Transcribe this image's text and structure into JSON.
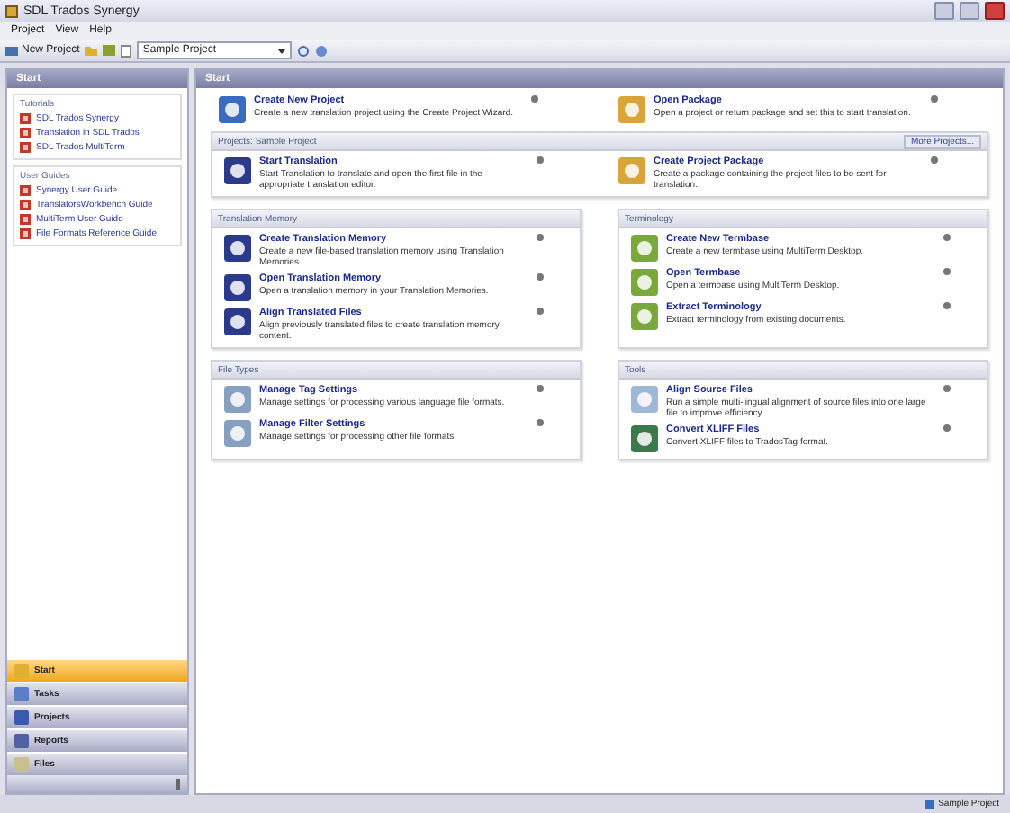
{
  "window": {
    "title": "SDL Trados Synergy"
  },
  "menu": [
    "Project",
    "View",
    "Help"
  ],
  "toolbar": {
    "new_project": "New Project",
    "project_select": "Sample Project"
  },
  "left_pane": {
    "title": "Start",
    "groups": [
      {
        "title": "Tutorials",
        "items": [
          "SDL Trados Synergy",
          "Translation in SDL Trados",
          "SDL Trados MultiTerm"
        ]
      },
      {
        "title": "User Guides",
        "items": [
          "Synergy User Guide",
          "TranslatorsWorkbench Guide",
          "MultiTerm User Guide",
          "File Formats Reference Guide"
        ]
      }
    ]
  },
  "nav": [
    {
      "label": "Start",
      "selected": true
    },
    {
      "label": "Tasks",
      "selected": false
    },
    {
      "label": "Projects",
      "selected": false
    },
    {
      "label": "Reports",
      "selected": false
    },
    {
      "label": "Files",
      "selected": false
    }
  ],
  "main": {
    "title": "Start",
    "top_actions": [
      {
        "title": "Create New Project",
        "desc": "Create a new translation project using the Create Project Wizard."
      },
      {
        "title": "Open Package",
        "desc": "Open a project or return package and set this to start translation."
      }
    ],
    "sections": [
      {
        "title": "Projects: Sample Project",
        "kind": "wide",
        "link": "More Projects...",
        "actions": [
          {
            "title": "Start Translation",
            "desc": "Start Translation to translate and open the first file in the appropriate translation editor."
          },
          {
            "title": "Create Project Package",
            "desc": "Create a package containing the project files to be sent for translation."
          }
        ]
      },
      {
        "title": "Translation Memory",
        "kind": "column",
        "actions": [
          {
            "title": "Create Translation Memory",
            "desc": "Create a new file-based translation memory using Translation Memories."
          },
          {
            "title": "Open Translation Memory",
            "desc": "Open a translation memory in your Translation Memories."
          },
          {
            "title": "Align Translated Files",
            "desc": "Align previously translated files to create translation memory content."
          }
        ]
      },
      {
        "title": "Terminology",
        "kind": "column",
        "actions": [
          {
            "title": "Create New Termbase",
            "desc": "Create a new termbase using MultiTerm Desktop."
          },
          {
            "title": "Open Termbase",
            "desc": "Open a termbase using MultiTerm Desktop."
          },
          {
            "title": "Extract Terminology",
            "desc": "Extract terminology from existing documents."
          }
        ]
      },
      {
        "title": "File Types",
        "kind": "column",
        "actions": [
          {
            "title": "Manage Tag Settings",
            "desc": "Manage settings for processing various language file formats."
          },
          {
            "title": "Manage Filter Settings",
            "desc": "Manage settings for processing other file formats."
          }
        ]
      },
      {
        "title": "Tools",
        "kind": "column",
        "actions": [
          {
            "title": "Align Source Files",
            "desc": "Run a simple multi-lingual alignment of source files into one large file to improve efficiency."
          },
          {
            "title": "Convert XLIFF Files",
            "desc": "Convert XLIFF files to TradosTag format."
          }
        ]
      }
    ]
  },
  "status_bar": {
    "text": "Sample Project"
  }
}
